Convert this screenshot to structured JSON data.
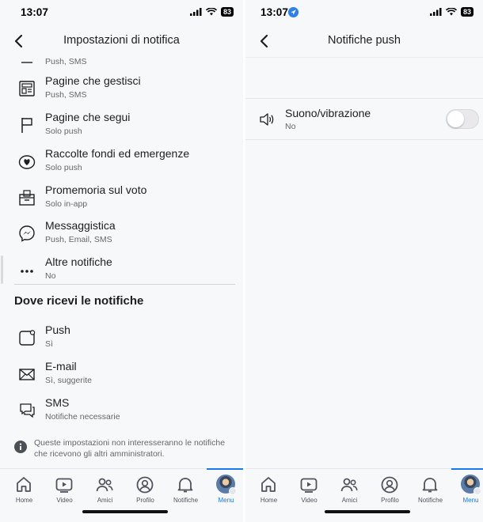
{
  "left": {
    "status": {
      "time": "13:07",
      "battery": "83"
    },
    "header": {
      "title": "Impostazioni di notifica"
    },
    "partial_row": {
      "subtitle": "Push, SMS"
    },
    "rows": [
      {
        "title": "Pagine che gestisci",
        "subtitle": "Push, SMS",
        "icon": "pages-icon"
      },
      {
        "title": "Pagine che segui",
        "subtitle": "Solo push",
        "icon": "flag-icon"
      },
      {
        "title": "Raccolte fondi ed emergenze",
        "subtitle": "Solo push",
        "icon": "fundraiser-heart-icon"
      },
      {
        "title": "Promemoria sul voto",
        "subtitle": "Solo in-app",
        "icon": "ballot-box-icon"
      },
      {
        "title": "Messaggistica",
        "subtitle": "Push, Email, SMS",
        "icon": "messenger-icon"
      },
      {
        "title": "Altre notifiche",
        "subtitle": "No",
        "icon": "more-dots-icon"
      }
    ],
    "section": {
      "heading": "Dove ricevi le notifiche"
    },
    "channels": [
      {
        "title": "Push",
        "subtitle": "Sì",
        "icon": "push-square-icon"
      },
      {
        "title": "E-mail",
        "subtitle": "Sì, suggerite",
        "icon": "envelope-icon"
      },
      {
        "title": "SMS",
        "subtitle": "Notifiche necessarie",
        "icon": "sms-bubble-icon"
      }
    ],
    "info_note": "Queste impostazioni non interesseranno le notifiche che ricevono gli altri amministratori."
  },
  "right": {
    "status": {
      "time": "13:07",
      "battery": "83"
    },
    "header": {
      "title": "Notifiche push"
    },
    "sound_setting": {
      "title": "Suono/vibrazione",
      "subtitle": "No",
      "enabled": false
    }
  },
  "tabs": [
    {
      "label": "Home",
      "icon": "home-icon"
    },
    {
      "label": "Video",
      "icon": "video-icon"
    },
    {
      "label": "Amici",
      "icon": "friends-icon"
    },
    {
      "label": "Profilo",
      "icon": "profile-icon"
    },
    {
      "label": "Notifiche",
      "icon": "bell-icon"
    },
    {
      "label": "Menu",
      "icon": "avatar-menu-icon"
    }
  ],
  "colors": {
    "accent": "#1877f2",
    "background": "#f7f8fa",
    "text": "#1c1e21",
    "secondary_text": "#65676b"
  }
}
